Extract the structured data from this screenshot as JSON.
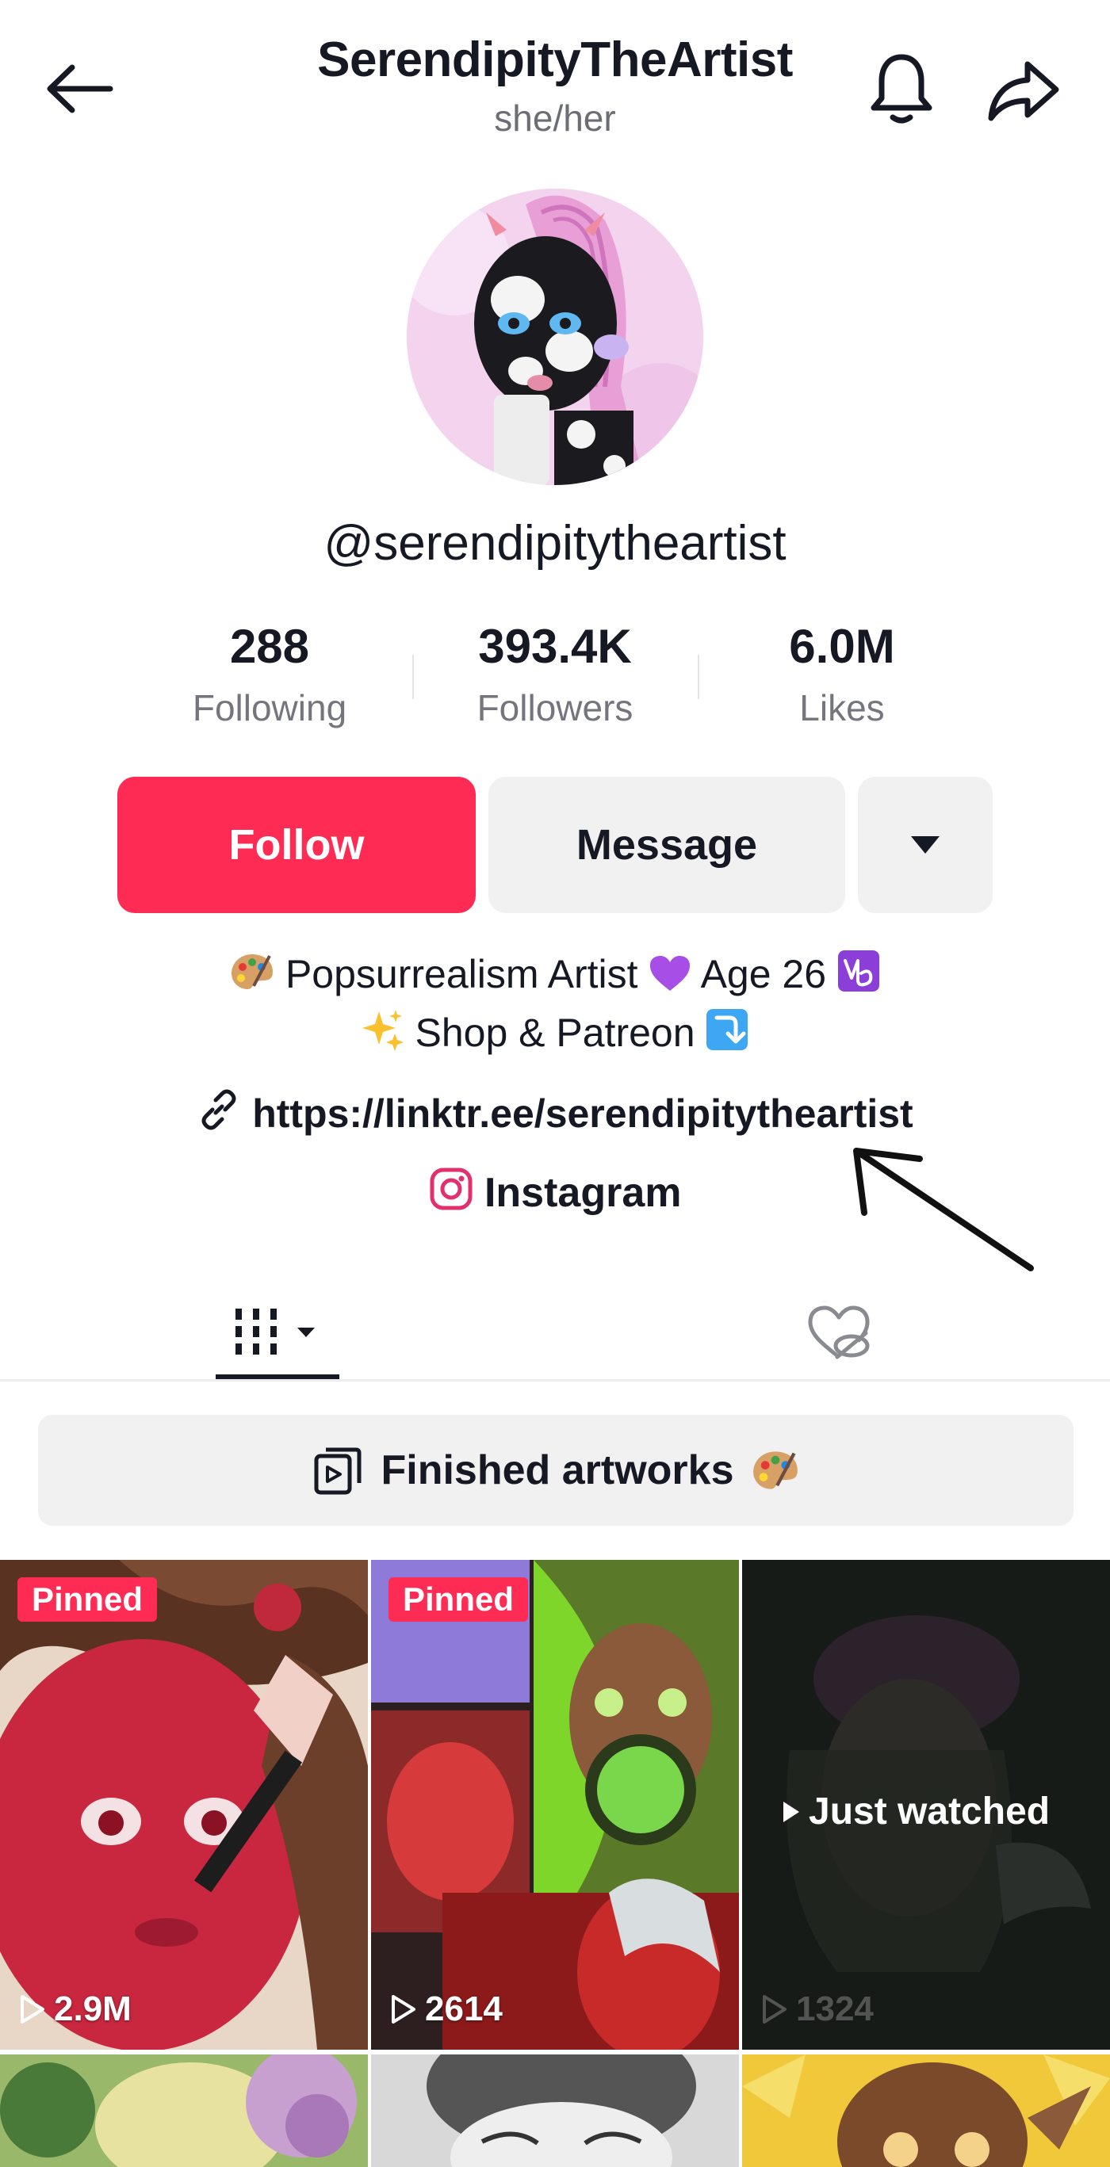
{
  "header": {
    "title": "SerendipityTheArtist",
    "pronouns": "she/her"
  },
  "profile": {
    "username": "@serendipitytheartist"
  },
  "stats": [
    {
      "value": "288",
      "label": "Following"
    },
    {
      "value": "393.4K",
      "label": "Followers"
    },
    {
      "value": "6.0M",
      "label": "Likes"
    }
  ],
  "actions": {
    "follow_label": "Follow",
    "message_label": "Message"
  },
  "bio": {
    "line1_text_a": "Popsurrealism Artist",
    "line1_text_b": "Age 26",
    "line2_text": "Shop & Patreon",
    "link": "https://linktr.ee/serendipitytheartist",
    "instagram": "Instagram"
  },
  "playlist": {
    "label": "Finished artworks"
  },
  "videos": [
    {
      "badge": "Pinned",
      "views": "2.9M"
    },
    {
      "badge": "Pinned",
      "views": "2614"
    },
    {
      "overlay": "Just watched",
      "views": "1324"
    }
  ],
  "colors": {
    "accent": "#fe2c55",
    "text": "#161823",
    "secondary_text": "#75767d",
    "button_bg": "#f1f1f2"
  },
  "icons": {
    "back": "arrow-left-icon",
    "notifications": "bell-icon",
    "share": "share-arrow-icon",
    "more": "caret-down-icon",
    "link": "link-icon",
    "instagram": "instagram-icon",
    "videos_tab": "grid-icon",
    "liked_tab": "hidden-heart-icon",
    "playlist": "playlist-icon",
    "play": "play-icon"
  }
}
